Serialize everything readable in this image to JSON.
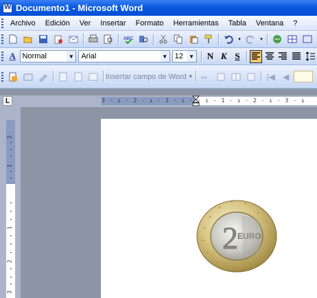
{
  "window": {
    "title": "Documento1 - Microsoft Word"
  },
  "menu": [
    "Archivo",
    "Edición",
    "Ver",
    "Insertar",
    "Formato",
    "Herramientas",
    "Tabla",
    "Ventana",
    "?"
  ],
  "formatting": {
    "style_icon_label": "A",
    "style": "Normal",
    "font": "Arial",
    "size": "12",
    "bold": "N",
    "italic": "K",
    "underline": "S"
  },
  "mailmerge": {
    "insert_field": "Insertar campo de Word"
  },
  "ruler": {
    "tab_selector": "L",
    "horizontal": "3 · ı · 2 · ı · 1 · ı ·  · ı · 1 · ı · 2 · ı · 3 · ı",
    "vertical": [
      "2",
      "1",
      "1",
      "2",
      "3"
    ]
  },
  "colors": {
    "title_bar": "#0a5ae0",
    "active_button": "#ffc66b",
    "workspace": "#8d94a6"
  },
  "content": {
    "image": "two-euro-coin"
  }
}
